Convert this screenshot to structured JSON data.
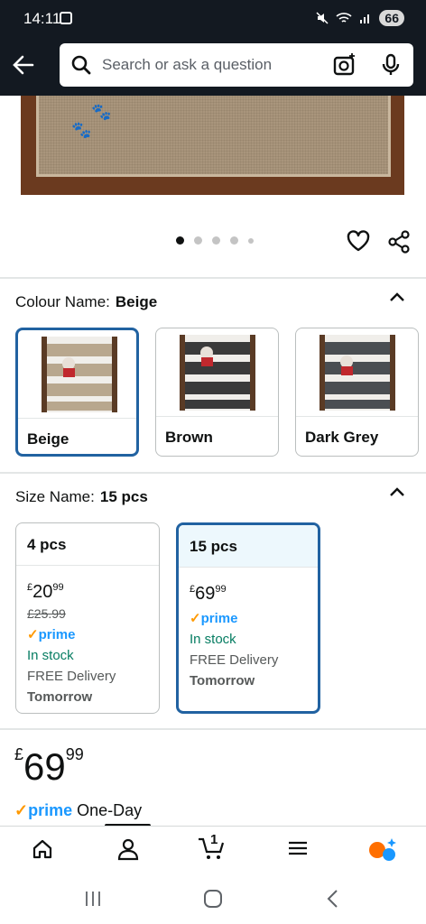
{
  "status_bar": {
    "time": "14:11",
    "battery": "66"
  },
  "search": {
    "placeholder": "Search or ask a question"
  },
  "carousel": {
    "dot_count": 5,
    "active_index": 0
  },
  "colour": {
    "label": "Colour Name:",
    "selected": "Beige",
    "options": [
      {
        "name": "Beige",
        "selected": true,
        "step_color": "#b8a78e"
      },
      {
        "name": "Brown",
        "selected": false,
        "step_color": "#3a3a3a"
      },
      {
        "name": "Dark Grey",
        "selected": false,
        "step_color": "#4a4e52"
      }
    ]
  },
  "size": {
    "label": "Size Name:",
    "selected": "15 pcs",
    "options": [
      {
        "name": "4 pcs",
        "selected": false,
        "currency": "£",
        "price_whole": "20",
        "price_fraction": "99",
        "was_price": "£25.99",
        "prime": "prime",
        "stock": "In stock",
        "delivery": "FREE Delivery",
        "delivery_day": "Tomorrow"
      },
      {
        "name": "15 pcs",
        "selected": true,
        "currency": "£",
        "price_whole": "69",
        "price_fraction": "99",
        "was_price": "",
        "prime": "prime",
        "stock": "In stock",
        "delivery": "FREE Delivery",
        "delivery_day": "Tomorrow"
      }
    ]
  },
  "price": {
    "currency": "£",
    "whole": "69",
    "fraction": "99"
  },
  "prime_line": {
    "brand": "prime",
    "text": "One-Day"
  },
  "bottom_nav": {
    "cart_count": "1"
  },
  "colors": {
    "header_bg": "#131921",
    "selected_border": "#2162a1",
    "prime_blue": "#1a98ff",
    "stock_green": "#067d62"
  }
}
